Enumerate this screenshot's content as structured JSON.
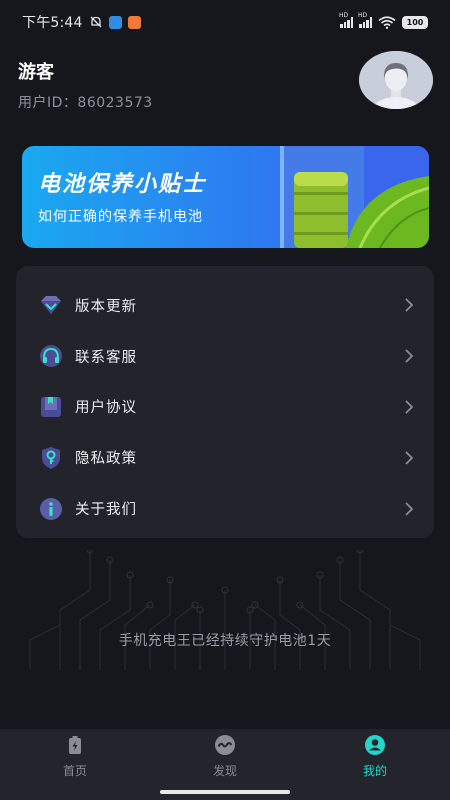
{
  "status_bar": {
    "time": "下午5:44",
    "signal_label_1": "HD",
    "signal_label_2": "HD",
    "battery": "100"
  },
  "profile": {
    "name": "游客",
    "user_id": "用户ID：86023573"
  },
  "banner": {
    "title": "电池保养小贴士",
    "subtitle": "如何正确的保养手机电池"
  },
  "menu": {
    "items": [
      {
        "label": "版本更新",
        "icon": "diamond-icon"
      },
      {
        "label": "联系客服",
        "icon": "headset-icon"
      },
      {
        "label": "用户协议",
        "icon": "book-icon"
      },
      {
        "label": "隐私政策",
        "icon": "shield-key-icon"
      },
      {
        "label": "关于我们",
        "icon": "info-icon"
      }
    ]
  },
  "guard_text": "手机充电王已经持续守护电池1天",
  "bottom_nav": {
    "items": [
      {
        "label": "首页",
        "icon": "battery-charge-icon",
        "active": false
      },
      {
        "label": "发现",
        "icon": "wave-circle-icon",
        "active": false
      },
      {
        "label": "我的",
        "icon": "person-circle-icon",
        "active": true
      }
    ]
  },
  "colors": {
    "background": "#16171d",
    "card": "#22232b",
    "accent": "#24d6c8",
    "banner_start": "#1aa9f0",
    "banner_end": "#3b5ef0"
  }
}
